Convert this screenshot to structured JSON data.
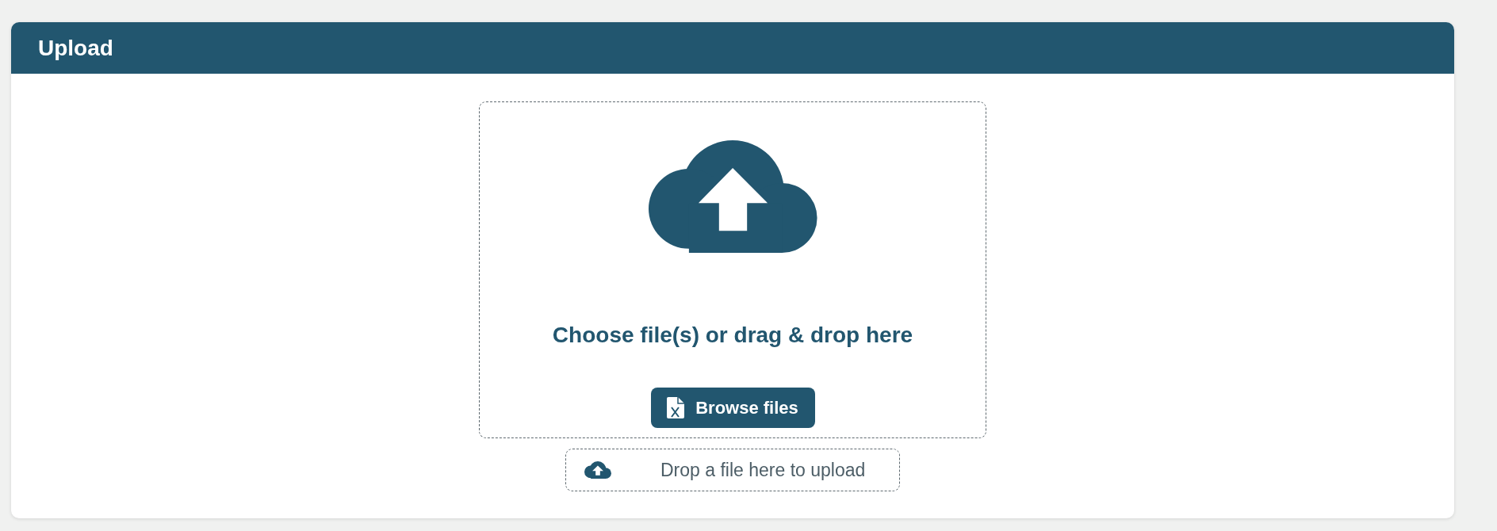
{
  "panel": {
    "title": "Upload"
  },
  "drop_zone": {
    "prompt": "Choose file(s) or drag & drop here",
    "button": "Browse files"
  },
  "drop_bar": {
    "label": "Drop a file here to upload"
  }
}
